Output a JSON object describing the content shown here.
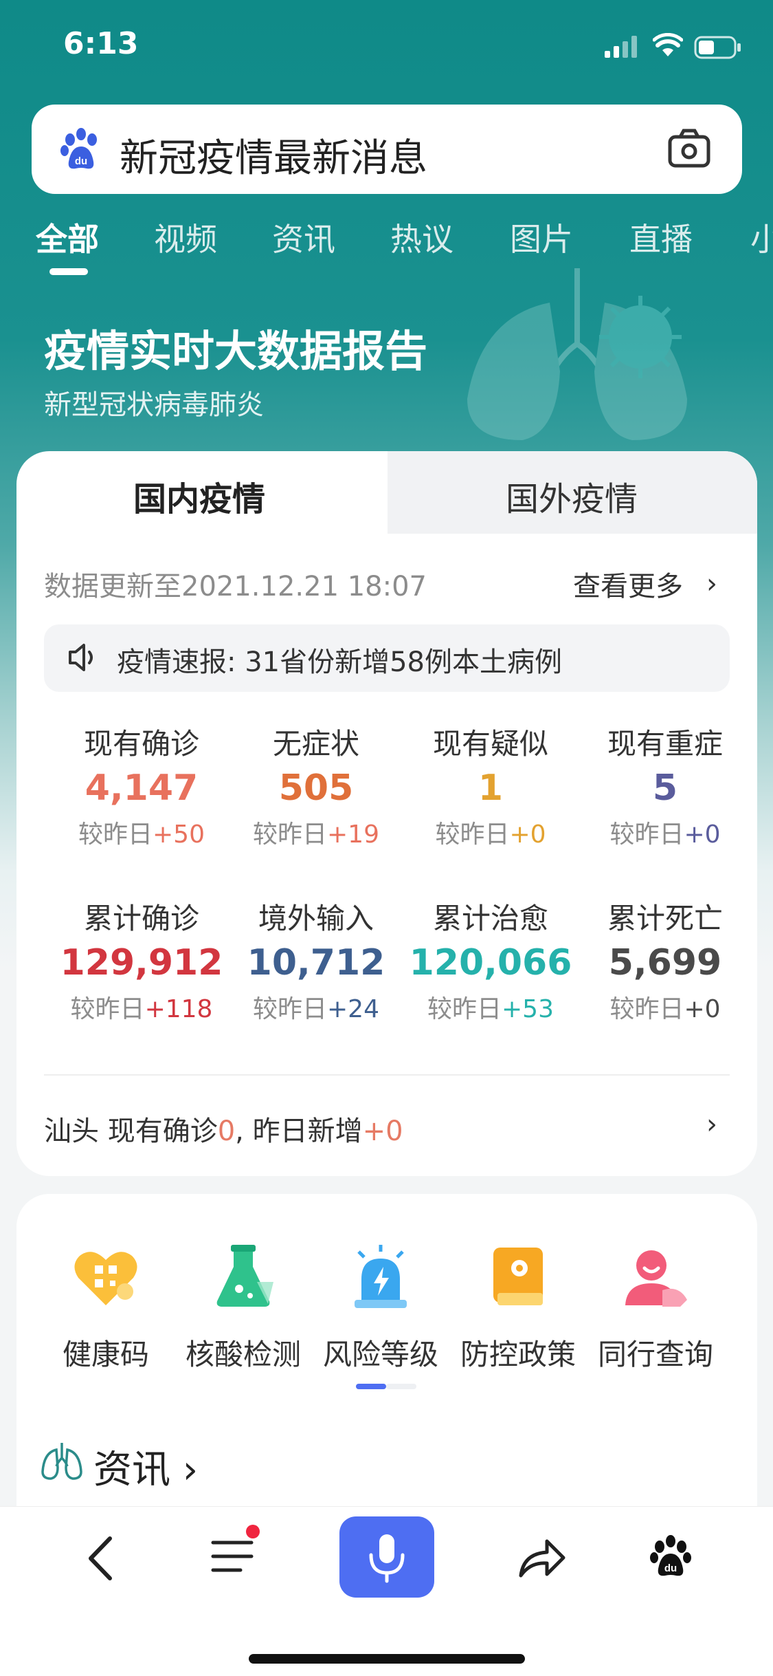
{
  "status_bar": {
    "time": "6:13"
  },
  "search": {
    "query": "新冠疫情最新消息"
  },
  "tabs": [
    {
      "label": "全部",
      "active": true
    },
    {
      "label": "视频"
    },
    {
      "label": "资讯"
    },
    {
      "label": "热议"
    },
    {
      "label": "图片"
    },
    {
      "label": "直播"
    },
    {
      "label": "小"
    }
  ],
  "hero": {
    "title": "疫情实时大数据报告",
    "subtitle": "新型冠状病毒肺炎"
  },
  "report": {
    "tab_domestic": "国内疫情",
    "tab_foreign": "国外疫情",
    "updated": "数据更新至2021.12.21 18:07",
    "more": "查看更多",
    "news": "疫情速报: 31省份新增58例本土病例",
    "stats": [
      {
        "label": "现有确诊",
        "value": "4,147",
        "change_prefix": "较昨日",
        "change": "+50",
        "color": "#e8715d",
        "change_color": "#e8715d"
      },
      {
        "label": "无症状",
        "value": "505",
        "change_prefix": "较昨日",
        "change": "+19",
        "color": "#e0703a",
        "change_color": "#e8715d"
      },
      {
        "label": "现有疑似",
        "value": "1",
        "change_prefix": "较昨日",
        "change": "+0",
        "color": "#e3a230",
        "change_color": "#e3a230"
      },
      {
        "label": "现有重症",
        "value": "5",
        "change_prefix": "较昨日",
        "change": "+0",
        "color": "#5a5c9c",
        "change_color": "#5a5c9c"
      },
      {
        "label": "累计确诊",
        "value": "129,912",
        "change_prefix": "较昨日",
        "change": "+118",
        "color": "#d2363f",
        "change_color": "#d2363f"
      },
      {
        "label": "境外输入",
        "value": "10,712",
        "change_prefix": "较昨日",
        "change": "+24",
        "color": "#3e5f8f",
        "change_color": "#3e5f8f"
      },
      {
        "label": "累计治愈",
        "value": "120,066",
        "change_prefix": "较昨日",
        "change": "+53",
        "color": "#25b1ab",
        "change_color": "#25b1ab"
      },
      {
        "label": "累计死亡",
        "value": "5,699",
        "change_prefix": "较昨日",
        "change": "+0",
        "color": "#4a4a4a",
        "change_color": "#4a4a4a"
      }
    ],
    "local": {
      "prefix": "汕头  现有确诊",
      "current": "0",
      "middle": ", 昨日新增",
      "new": "+0"
    }
  },
  "services": [
    {
      "label": "健康码",
      "icon": "health-code-icon"
    },
    {
      "label": "核酸检测",
      "icon": "flask-icon"
    },
    {
      "label": "风险等级",
      "icon": "alarm-icon"
    },
    {
      "label": "防控政策",
      "icon": "policy-book-icon"
    },
    {
      "label": "同行查询",
      "icon": "companion-icon"
    }
  ],
  "info": {
    "title": "资讯"
  },
  "colors": {
    "brand_teal": "#0f8a88",
    "mic_blue": "#4e6ef2"
  }
}
